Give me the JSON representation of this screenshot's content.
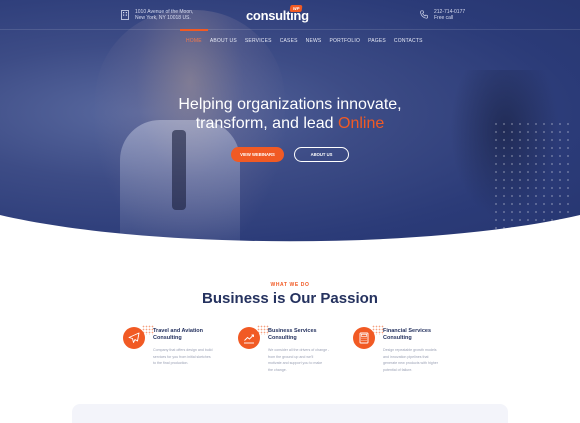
{
  "header": {
    "address_line1": "1010 Avenue of the Moon,",
    "address_line2": "New York, NY 10018 US.",
    "logo_text": "consulting",
    "logo_badge": "WP",
    "phone_line1": "212-714-0177",
    "phone_line2": "Free call"
  },
  "nav": {
    "items": [
      "HOME",
      "ABOUT US",
      "SERVICES",
      "CASES",
      "NEWS",
      "PORTFOLIO",
      "PAGES",
      "CONTACTS"
    ],
    "active": "HOME"
  },
  "hero": {
    "headline_line1": "Helping organizations innovate,",
    "headline_line2_prefix": "transform, and lead ",
    "headline_accent": "Online",
    "primary_button": "VIEW WEBINARS",
    "secondary_button": "ABOUT US"
  },
  "what_we_do": {
    "eyebrow": "WHAT WE DO",
    "title": "Business is Our Passion",
    "services": [
      {
        "icon": "airplane-icon",
        "title_line1": "Travel and Aviation",
        "title_line2": "Consulting",
        "desc_line1": "Company that offers design and build",
        "desc_line2": "services for you from initial sketches",
        "desc_line3": "to the final production."
      },
      {
        "icon": "chart-icon",
        "title_line1": "Business Services",
        "title_line2": "Consulting",
        "desc_line1": "We consider all the drivers of change -",
        "desc_line2": "from the ground up and we'll",
        "desc_line3": "motivate and support you to make",
        "desc_line4": "the change."
      },
      {
        "icon": "calculator-icon",
        "title_line1": "Financial Services",
        "title_line2": "Consulting",
        "desc_line1": "Design repeatable growth models",
        "desc_line2": "and innovation pipelines that",
        "desc_line3": "generate new products with higher",
        "desc_line4": "potential of failure."
      }
    ]
  },
  "colors": {
    "accent": "#f15a24",
    "hero_bg": "#2b3b78",
    "heading": "#25325f"
  }
}
